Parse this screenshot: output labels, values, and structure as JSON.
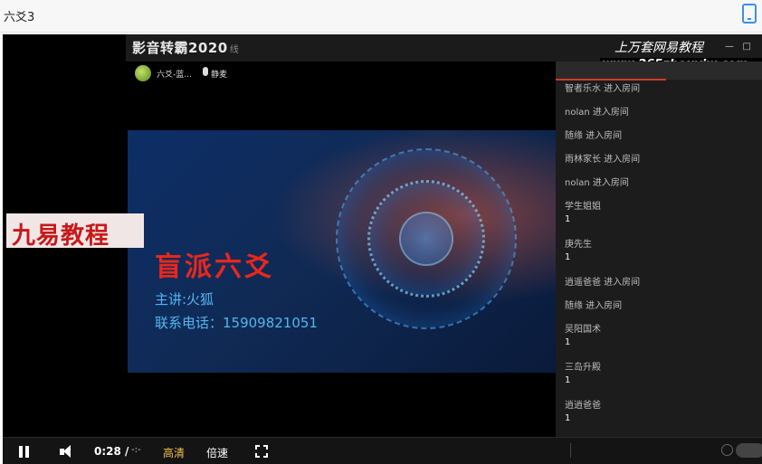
{
  "page": {
    "title": "六爻3"
  },
  "app": {
    "title": "影音转霸2020",
    "title_suffix": "线",
    "host_name": "六爻-蓝...",
    "mic_label": "静麦"
  },
  "watermarks": {
    "left": "九易教程",
    "right_line1": "上万套网易教程",
    "right_line2": "www.265zhouyiw.com"
  },
  "slide": {
    "title": "盲派六爻",
    "lecturer": "主讲:火狐",
    "phone": "联系电话：15909821051"
  },
  "chat": [
    {
      "name": "智者乐水 进入房间",
      "count": ""
    },
    {
      "name": "nolan 进入房间",
      "count": ""
    },
    {
      "name": "随缘 进入房间",
      "count": ""
    },
    {
      "name": "雨林家长 进入房间",
      "count": ""
    },
    {
      "name": "nolan 进入房间",
      "count": ""
    },
    {
      "name": "学生姐姐",
      "count": "1"
    },
    {
      "name": "庚先生",
      "count": "1"
    },
    {
      "name": "逍遥爸爸 进入房间",
      "count": ""
    },
    {
      "name": "随缘 进入房间",
      "count": ""
    },
    {
      "name": "吴阳国术",
      "count": "1"
    },
    {
      "name": "三岛升殿",
      "count": "1"
    },
    {
      "name": "逍逍爸爸",
      "count": "1"
    }
  ],
  "controls": {
    "time": "0:28 /",
    "seek": "-:-",
    "quality": "高清",
    "speed": "倍速"
  },
  "colors": {
    "accent_red": "#e8271d",
    "text_blue": "#52b6f0",
    "quality_yellow": "#f2c24a",
    "phone_icon": "#3d8fe6"
  }
}
